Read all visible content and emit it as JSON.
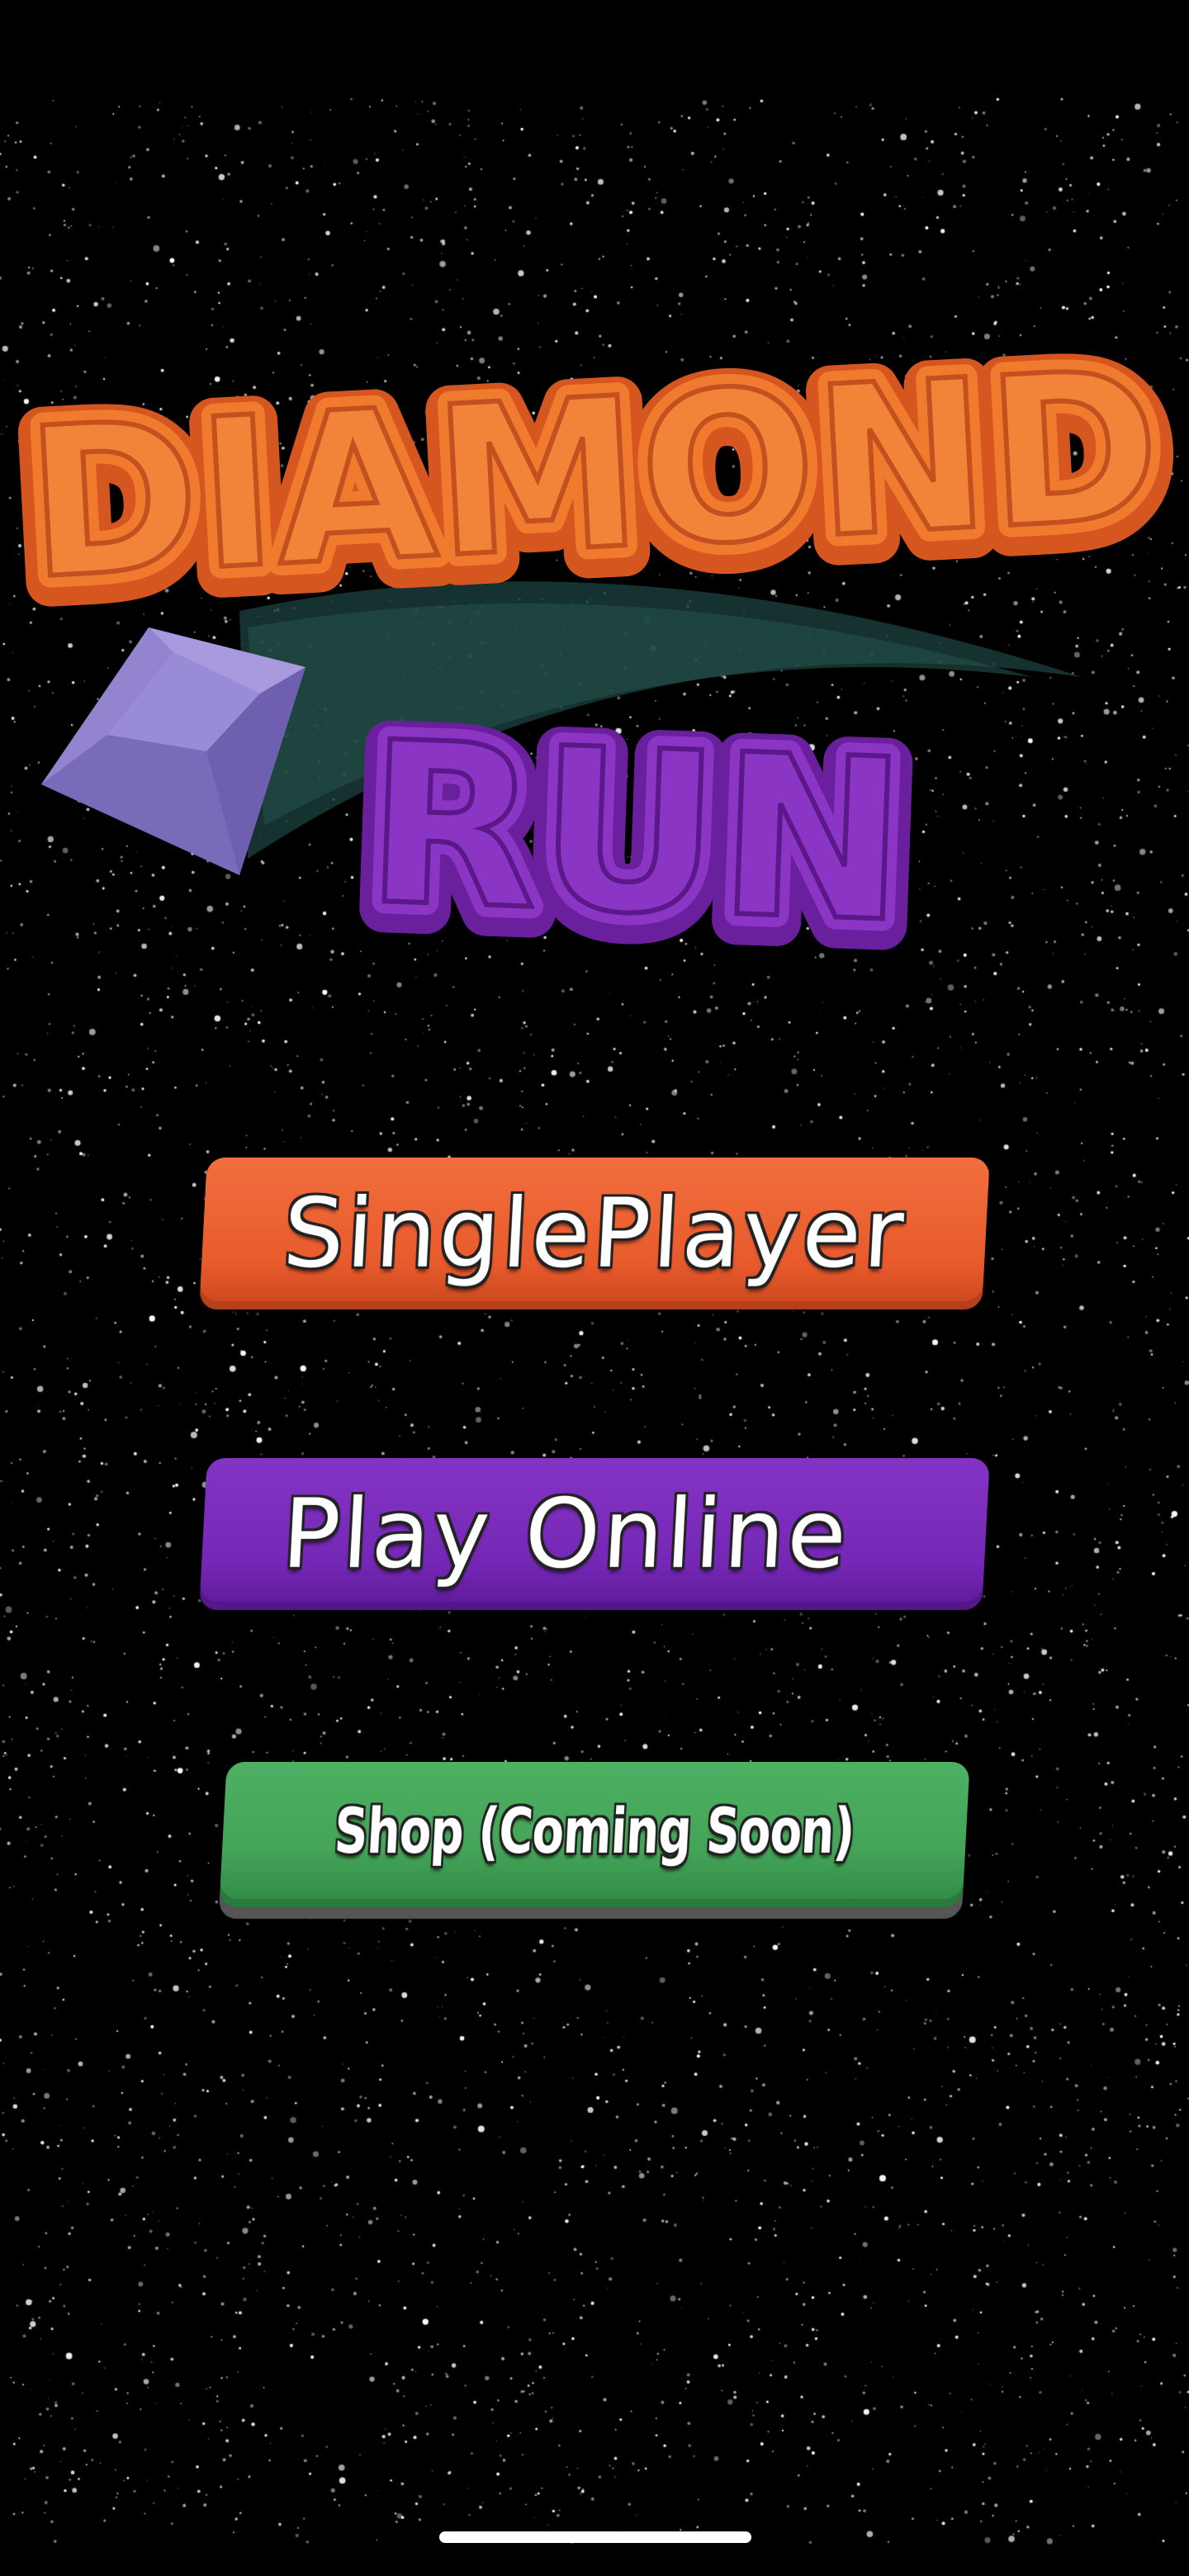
{
  "app": {
    "name_line1": "DIAMOND",
    "name_line2": "RUN"
  },
  "menu": {
    "single_player_label": "SinglePlayer",
    "play_online_label": "Play Online",
    "shop_label": "Shop (Coming Soon)"
  },
  "icons": {
    "logo_gem": "diamond-icon"
  },
  "colors": {
    "background": "#000000",
    "title_orange": "#f07a2e",
    "title_purple": "#8a35c4",
    "gem_purple": "#8a78c8",
    "single_player_button": "#e85a2c",
    "play_online_button": "#7427b5",
    "shop_button": "#44a458"
  }
}
